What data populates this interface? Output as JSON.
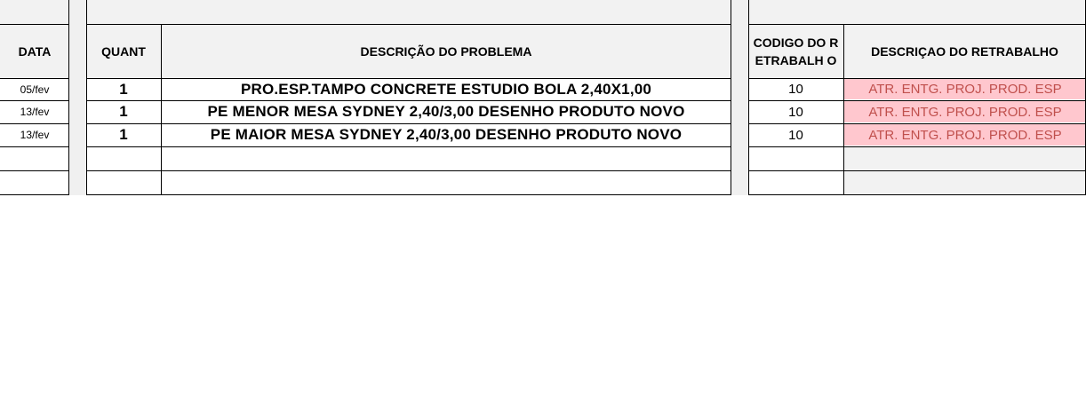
{
  "headers": {
    "data": "DATA",
    "quant": "QUANT",
    "descricao_problema": "DESCRIÇÃO DO PROBLEMA",
    "codigo_retrabalho": "CODIGO DO RETRABALH O",
    "descricao_retrabalho": "DESCRIÇAO DO RETRABALHO"
  },
  "rows": [
    {
      "data": "05/fev",
      "quant": "1",
      "problema": "PRO.ESP.TAMPO CONCRETE ESTUDIO BOLA 2,40X1,00",
      "codigo": "10",
      "retrabalho": "ATR. ENTG. PROJ. PROD. ESP"
    },
    {
      "data": "13/fev",
      "quant": "1",
      "problema": "PE MENOR MESA SYDNEY 2,40/3,00 DESENHO PRODUTO NOVO",
      "codigo": "10",
      "retrabalho": "ATR. ENTG. PROJ. PROD. ESP"
    },
    {
      "data": "13/fev",
      "quant": "1",
      "problema": "PE MAIOR MESA SYDNEY 2,40/3,00 DESENHO PRODUTO NOVO",
      "codigo": "10",
      "retrabalho": "ATR. ENTG. PROJ. PROD. ESP"
    }
  ],
  "colors": {
    "header_bg": "#f2f2f2",
    "rework_bg": "#ffc7ce",
    "rework_text": "#c0504d"
  }
}
